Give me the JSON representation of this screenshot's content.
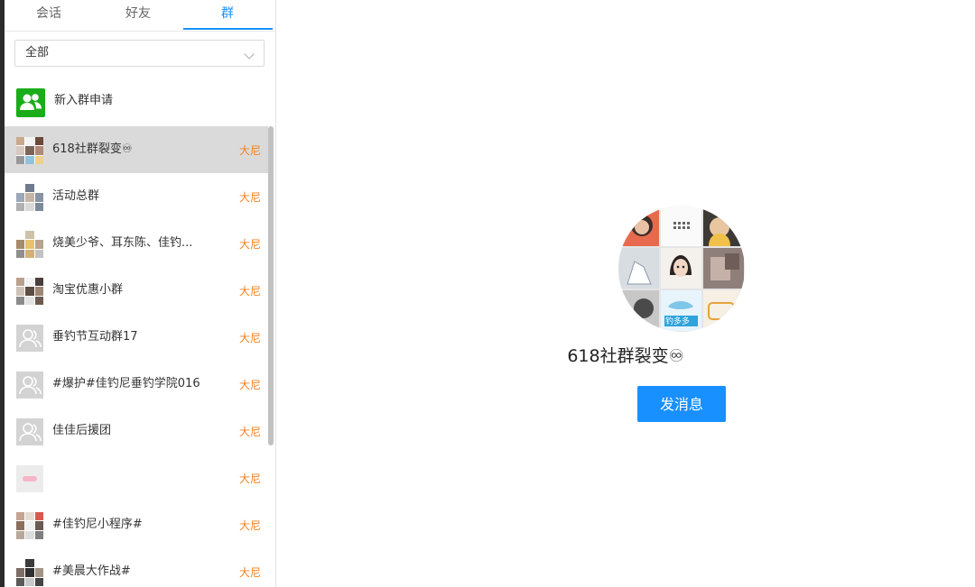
{
  "tabs": [
    {
      "label": "会话"
    },
    {
      "label": "好友"
    },
    {
      "label": "群"
    }
  ],
  "filter": {
    "selected": "全部"
  },
  "new_group_request": {
    "label": "新入群申请"
  },
  "groups": [
    {
      "name": "618社群裂变♾",
      "tag": "大尼",
      "selected": true
    },
    {
      "name": "活动总群",
      "tag": "大尼"
    },
    {
      "name": "烧美少爷、耳东陈、佳钓...",
      "tag": "大尼"
    },
    {
      "name": "淘宝优惠小群",
      "tag": "大尼"
    },
    {
      "name": "垂钓节互动群17",
      "tag": "大尼"
    },
    {
      "name": "#爆护#佳钓尼垂钓学院016",
      "tag": "大尼"
    },
    {
      "name": "佳佳后援团",
      "tag": "大尼"
    },
    {
      "name": "",
      "tag": "大尼"
    },
    {
      "name": "#佳钓尼小程序#",
      "tag": "大尼"
    },
    {
      "name": "#美晨大作战#",
      "tag": "大尼"
    }
  ],
  "detail": {
    "title": "618社群裂变♾",
    "send_button": "发消息",
    "avatar_text": "钓多多"
  },
  "colors": {
    "accent": "#1890ff",
    "tag": "#f5811f",
    "new_request_icon": "#1aad19",
    "selected_row": "#dadada"
  }
}
